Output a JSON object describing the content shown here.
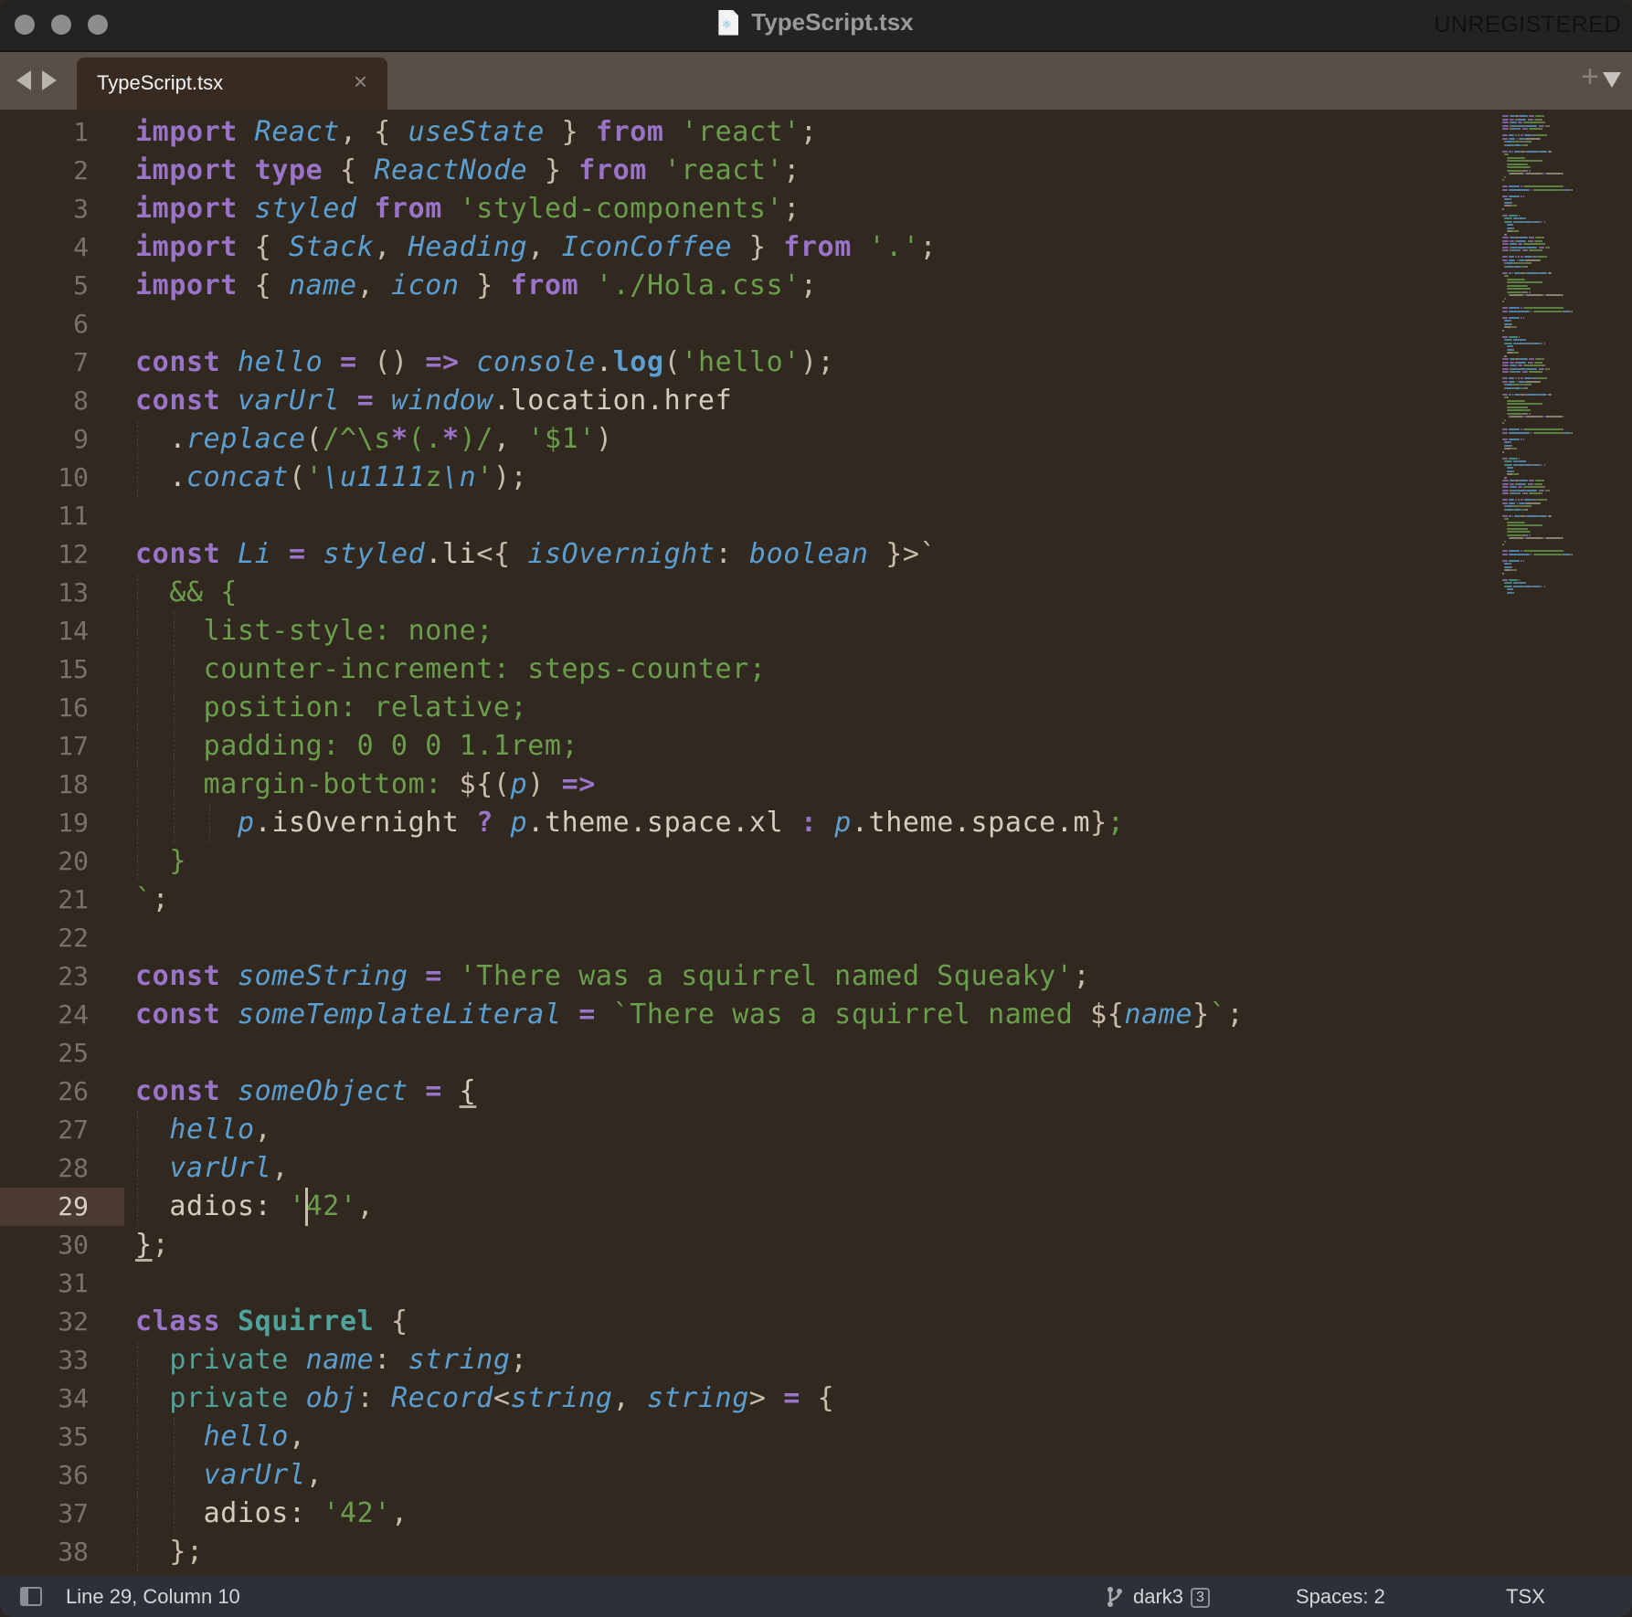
{
  "window": {
    "title": "TypeScript.tsx",
    "file_icon": "react-file-icon",
    "registration_notice": "UNREGISTERED"
  },
  "tabs": {
    "nav_back": "left-arrow",
    "nav_forward": "right-arrow",
    "items": [
      {
        "label": "TypeScript.tsx",
        "active": true,
        "close": "×"
      }
    ],
    "new_tab": "+",
    "menu": "down-triangle"
  },
  "editor": {
    "current_line": 29,
    "line_numbers": [
      "1",
      "2",
      "3",
      "4",
      "5",
      "6",
      "7",
      "8",
      "9",
      "10",
      "11",
      "12",
      "13",
      "14",
      "15",
      "16",
      "17",
      "18",
      "19",
      "20",
      "21",
      "22",
      "23",
      "24",
      "25",
      "26",
      "27",
      "28",
      "29",
      "30",
      "31",
      "32",
      "33",
      "34",
      "35",
      "36",
      "37",
      "38"
    ],
    "lines": [
      [
        [
          "kw",
          "import"
        ],
        [
          "pl",
          " "
        ],
        [
          "id",
          "React"
        ],
        [
          "br",
          ", { "
        ],
        [
          "id",
          "useState"
        ],
        [
          "br",
          " } "
        ],
        [
          "kw",
          "from"
        ],
        [
          "pl",
          " "
        ],
        [
          "str",
          "'react'"
        ],
        [
          "br",
          ";"
        ]
      ],
      [
        [
          "kw",
          "import"
        ],
        [
          "pl",
          " "
        ],
        [
          "kw",
          "type"
        ],
        [
          "br",
          " { "
        ],
        [
          "id",
          "ReactNode"
        ],
        [
          "br",
          " } "
        ],
        [
          "kw",
          "from"
        ],
        [
          "pl",
          " "
        ],
        [
          "str",
          "'react'"
        ],
        [
          "br",
          ";"
        ]
      ],
      [
        [
          "kw",
          "import"
        ],
        [
          "pl",
          " "
        ],
        [
          "id",
          "styled"
        ],
        [
          "pl",
          " "
        ],
        [
          "kw",
          "from"
        ],
        [
          "pl",
          " "
        ],
        [
          "str",
          "'styled-components'"
        ],
        [
          "br",
          ";"
        ]
      ],
      [
        [
          "kw",
          "import"
        ],
        [
          "br",
          " { "
        ],
        [
          "id",
          "Stack"
        ],
        [
          "br",
          ", "
        ],
        [
          "id",
          "Heading"
        ],
        [
          "br",
          ", "
        ],
        [
          "id",
          "IconCoffee"
        ],
        [
          "br",
          " } "
        ],
        [
          "kw",
          "from"
        ],
        [
          "pl",
          " "
        ],
        [
          "str",
          "'.'"
        ],
        [
          "br",
          ";"
        ]
      ],
      [
        [
          "kw",
          "import"
        ],
        [
          "br",
          " { "
        ],
        [
          "id",
          "name"
        ],
        [
          "br",
          ", "
        ],
        [
          "id",
          "icon"
        ],
        [
          "br",
          " } "
        ],
        [
          "kw",
          "from"
        ],
        [
          "pl",
          " "
        ],
        [
          "str",
          "'./Hola.css'"
        ],
        [
          "br",
          ";"
        ]
      ],
      [],
      [
        [
          "kw",
          "const"
        ],
        [
          "pl",
          " "
        ],
        [
          "id",
          "hello"
        ],
        [
          "pl",
          " "
        ],
        [
          "op",
          "="
        ],
        [
          "pl",
          " "
        ],
        [
          "br",
          "()"
        ],
        [
          "pl",
          " "
        ],
        [
          "op",
          "=>"
        ],
        [
          "pl",
          " "
        ],
        [
          "id",
          "console"
        ],
        [
          "pl",
          "."
        ],
        [
          "fn",
          "log"
        ],
        [
          "br",
          "("
        ],
        [
          "str",
          "'hello'"
        ],
        [
          "br",
          ");"
        ]
      ],
      [
        [
          "kw",
          "const"
        ],
        [
          "pl",
          " "
        ],
        [
          "id",
          "varUrl"
        ],
        [
          "pl",
          " "
        ],
        [
          "op",
          "="
        ],
        [
          "pl",
          " "
        ],
        [
          "id",
          "window"
        ],
        [
          "pl",
          ".location.href"
        ]
      ],
      [
        [
          "pl",
          "  ."
        ],
        [
          "id",
          "replace"
        ],
        [
          "br",
          "("
        ],
        [
          "str",
          "/^\\s"
        ],
        [
          "op",
          "*"
        ],
        [
          "str",
          "(."
        ],
        [
          "op",
          "*"
        ],
        [
          "str",
          ")/"
        ],
        [
          "br",
          ", "
        ],
        [
          "str",
          "'$1'"
        ],
        [
          "br",
          ")"
        ]
      ],
      [
        [
          "pl",
          "  ."
        ],
        [
          "id",
          "concat"
        ],
        [
          "br",
          "("
        ],
        [
          "str",
          "'"
        ],
        [
          "id",
          "\\u1111"
        ],
        [
          "str",
          "z"
        ],
        [
          "id",
          "\\n"
        ],
        [
          "str",
          "'"
        ],
        [
          "br",
          ");"
        ]
      ],
      [],
      [
        [
          "kw",
          "const"
        ],
        [
          "pl",
          " "
        ],
        [
          "id",
          "Li"
        ],
        [
          "pl",
          " "
        ],
        [
          "op",
          "="
        ],
        [
          "pl",
          " "
        ],
        [
          "id",
          "styled"
        ],
        [
          "pl",
          ".li"
        ],
        [
          "br",
          "<{ "
        ],
        [
          "id",
          "isOvernight"
        ],
        [
          "br",
          ": "
        ],
        [
          "id",
          "boolean"
        ],
        [
          "br",
          " }>`"
        ]
      ],
      [
        [
          "css",
          "  && {"
        ]
      ],
      [
        [
          "css",
          "    list-style: none;"
        ]
      ],
      [
        [
          "css",
          "    counter-increment: steps-counter;"
        ]
      ],
      [
        [
          "css",
          "    position: relative;"
        ]
      ],
      [
        [
          "css",
          "    padding: 0 0 0 1.1rem;"
        ]
      ],
      [
        [
          "css",
          "    margin-bottom: "
        ],
        [
          "br",
          "${("
        ],
        [
          "id",
          "p"
        ],
        [
          "br",
          ")"
        ],
        [
          "pl",
          " "
        ],
        [
          "op",
          "=>"
        ]
      ],
      [
        [
          "pl",
          "      "
        ],
        [
          "id",
          "p"
        ],
        [
          "pl",
          ".isOvernight "
        ],
        [
          "op",
          "?"
        ],
        [
          "pl",
          " "
        ],
        [
          "id",
          "p"
        ],
        [
          "pl",
          ".theme.space.xl "
        ],
        [
          "op",
          ":"
        ],
        [
          "pl",
          " "
        ],
        [
          "id",
          "p"
        ],
        [
          "pl",
          ".theme.space.m"
        ],
        [
          "br",
          "}"
        ],
        [
          "css",
          ";"
        ]
      ],
      [
        [
          "css",
          "  }"
        ]
      ],
      [
        [
          "str",
          "`"
        ],
        [
          "br",
          ";"
        ]
      ],
      [],
      [
        [
          "kw",
          "const"
        ],
        [
          "pl",
          " "
        ],
        [
          "id",
          "someString"
        ],
        [
          "pl",
          " "
        ],
        [
          "op",
          "="
        ],
        [
          "pl",
          " "
        ],
        [
          "str",
          "'There was a squirrel named Squeaky'"
        ],
        [
          "br",
          ";"
        ]
      ],
      [
        [
          "kw",
          "const"
        ],
        [
          "pl",
          " "
        ],
        [
          "id",
          "someTemplateLiteral"
        ],
        [
          "pl",
          " "
        ],
        [
          "op",
          "="
        ],
        [
          "pl",
          " "
        ],
        [
          "str",
          "`There was a squirrel named "
        ],
        [
          "br",
          "${"
        ],
        [
          "id",
          "name"
        ],
        [
          "br",
          "}"
        ],
        [
          "str",
          "`"
        ],
        [
          "br",
          ";"
        ]
      ],
      [],
      [
        [
          "kw",
          "const"
        ],
        [
          "pl",
          " "
        ],
        [
          "id",
          "someObject"
        ],
        [
          "pl",
          " "
        ],
        [
          "op",
          "="
        ],
        [
          "pl",
          " "
        ],
        [
          "ul",
          "{"
        ]
      ],
      [
        [
          "pl",
          "  "
        ],
        [
          "id",
          "hello"
        ],
        [
          "br",
          ","
        ]
      ],
      [
        [
          "pl",
          "  "
        ],
        [
          "id",
          "varUrl"
        ],
        [
          "br",
          ","
        ]
      ],
      [
        [
          "pl",
          "  adios: "
        ],
        [
          "str",
          "'42'"
        ],
        [
          "br",
          ","
        ]
      ],
      [
        [
          "ul",
          "}"
        ],
        [
          "br",
          ";"
        ]
      ],
      [],
      [
        [
          "kw",
          "class"
        ],
        [
          "pl",
          " "
        ],
        [
          "cls",
          "Squirrel"
        ],
        [
          "br",
          " {"
        ]
      ],
      [
        [
          "pl",
          "  "
        ],
        [
          "priv",
          "private"
        ],
        [
          "pl",
          " "
        ],
        [
          "id",
          "name"
        ],
        [
          "br",
          ": "
        ],
        [
          "id",
          "string"
        ],
        [
          "br",
          ";"
        ]
      ],
      [
        [
          "pl",
          "  "
        ],
        [
          "priv",
          "private"
        ],
        [
          "pl",
          " "
        ],
        [
          "id",
          "obj"
        ],
        [
          "br",
          ": "
        ],
        [
          "id",
          "Record"
        ],
        [
          "br",
          "<"
        ],
        [
          "id",
          "string"
        ],
        [
          "br",
          ", "
        ],
        [
          "id",
          "string"
        ],
        [
          "br",
          ">"
        ],
        [
          "pl",
          " "
        ],
        [
          "op",
          "="
        ],
        [
          "br",
          " {"
        ]
      ],
      [
        [
          "pl",
          "    "
        ],
        [
          "id",
          "hello"
        ],
        [
          "br",
          ","
        ]
      ],
      [
        [
          "pl",
          "    "
        ],
        [
          "id",
          "varUrl"
        ],
        [
          "br",
          ","
        ]
      ],
      [
        [
          "pl",
          "    adios: "
        ],
        [
          "str",
          "'42'"
        ],
        [
          "br",
          ","
        ]
      ],
      [
        [
          "br",
          "  };"
        ]
      ]
    ]
  },
  "status_bar": {
    "panel_toggle": "sidebar-toggle-icon",
    "position": "Line 29, Column 10",
    "branch": "dark3",
    "branch_changes": "3",
    "indentation": "Spaces: 2",
    "syntax": "TSX"
  },
  "colors": {
    "keyword": "#9a74c9",
    "identifier": "#5b9fd2",
    "string": "#6a9e4c",
    "class_name": "#4fa39a",
    "plain": "#d5cbbf",
    "background": "#312820",
    "tabbar": "#5a4f47",
    "statusbar": "#2c3138"
  }
}
